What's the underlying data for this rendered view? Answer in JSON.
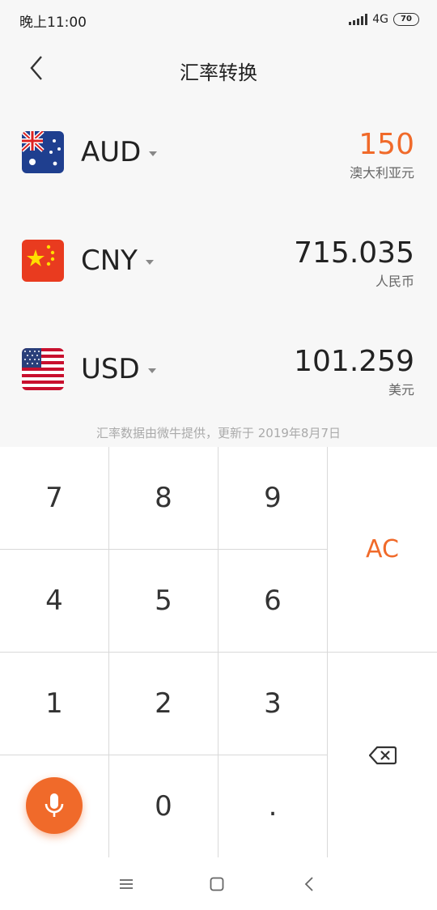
{
  "status": {
    "time": "晚上11:00",
    "network": "4G",
    "battery": "70"
  },
  "header": {
    "title": "汇率转换",
    "back_icon": "chevron-left-icon"
  },
  "currencies": [
    {
      "code": "AUD",
      "amount": "150",
      "name": "澳大利亚元",
      "flag": "australia-flag-icon",
      "active": true
    },
    {
      "code": "CNY",
      "amount": "715.035",
      "name": "人民币",
      "flag": "china-flag-icon",
      "active": false
    },
    {
      "code": "USD",
      "amount": "101.259",
      "name": "美元",
      "flag": "usa-flag-icon",
      "active": false
    }
  ],
  "note": "汇率数据由微牛提供，更新于 2019年8月7日",
  "keypad": {
    "k7": "7",
    "k8": "8",
    "k9": "9",
    "k4": "4",
    "k5": "5",
    "k6": "6",
    "k1": "1",
    "k2": "2",
    "k3": "3",
    "k0": "0",
    "kdot": ".",
    "clear": "AC",
    "backspace_icon": "backspace-icon",
    "mic_icon": "microphone-icon"
  },
  "colors": {
    "accent": "#f06a2a",
    "background": "#f7f7f7",
    "keypad_bg": "#ffffff",
    "divider": "#d9d9d9"
  },
  "navbar": {
    "menu_icon": "menu-icon",
    "home_icon": "square-home-icon",
    "back_icon": "back-chevron-icon"
  }
}
